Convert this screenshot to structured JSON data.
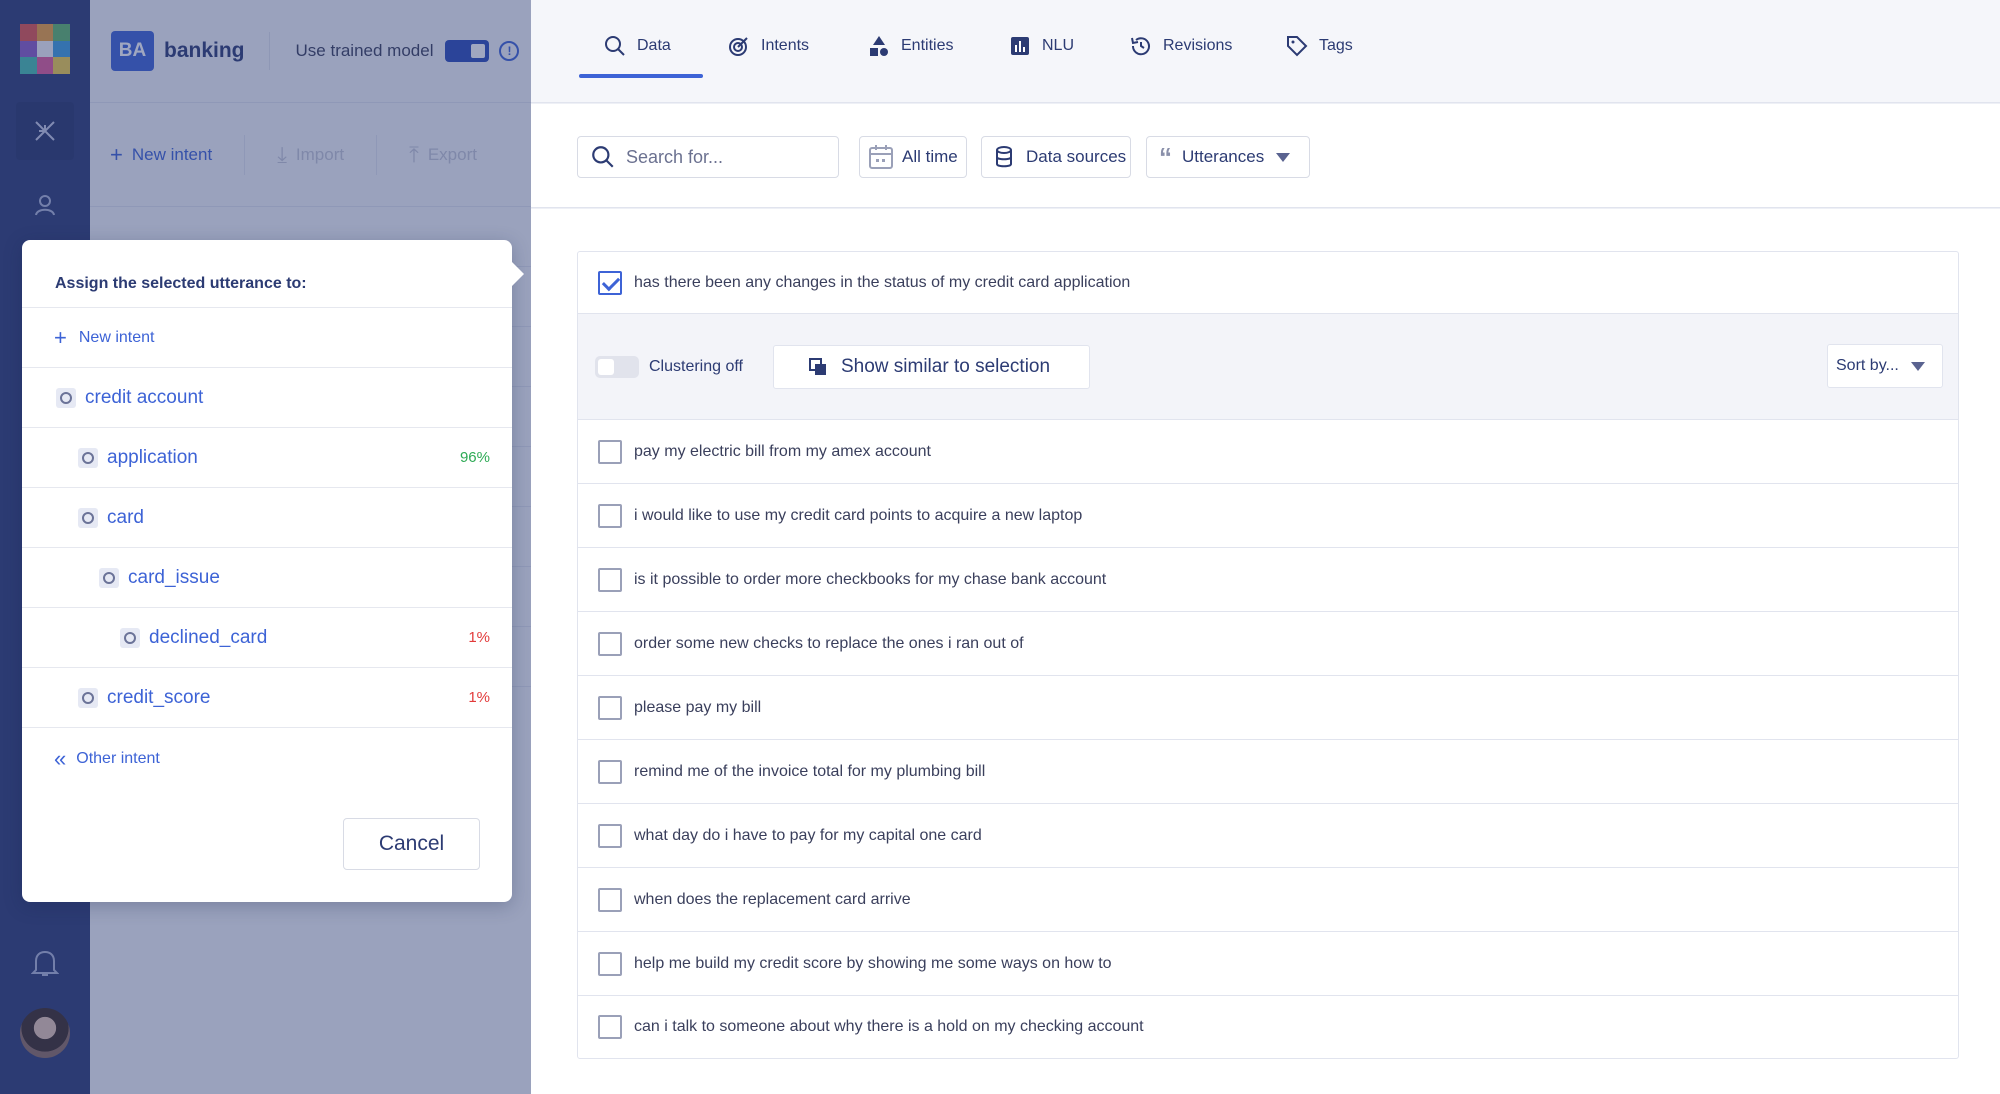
{
  "header": {
    "badge": "BA",
    "project": "banking",
    "trained_label": "Use trained model",
    "info": "!"
  },
  "toolbar": {
    "new_intent": "New intent",
    "import": "Import",
    "export": "Export"
  },
  "tabs": [
    {
      "label": "Data"
    },
    {
      "label": "Intents"
    },
    {
      "label": "Entities"
    },
    {
      "label": "NLU"
    },
    {
      "label": "Revisions"
    },
    {
      "label": "Tags"
    }
  ],
  "filters": {
    "search_placeholder": "Search for...",
    "time": "All time",
    "sources": "Data sources",
    "utterances": "Utterances"
  },
  "popup": {
    "title": "Assign the selected utterance to:",
    "new_intent": "New intent",
    "intents": [
      {
        "name": "credit account",
        "pct": ""
      },
      {
        "name": "application",
        "pct": "96%"
      },
      {
        "name": "card",
        "pct": ""
      },
      {
        "name": "card_issue",
        "pct": ""
      },
      {
        "name": "declined_card",
        "pct": "1%"
      },
      {
        "name": "credit_score",
        "pct": "1%"
      }
    ],
    "other_intent": "Other intent",
    "cancel": "Cancel"
  },
  "selected_utterance": "has there been any changes in the status of my credit card application",
  "clustering": {
    "label": "Clustering off",
    "similar": "Show similar to selection",
    "sort": "Sort by..."
  },
  "utterances": [
    "pay my electric bill from my amex account",
    "i would like to use my credit card points to acquire a new laptop",
    "is it possible to order more checkbooks for my chase bank account",
    "order some new checks to replace the ones i ran out of",
    "please pay my bill",
    "remind me of the invoice total for my plumbing bill",
    "what day do i have to pay for my capital one card",
    "when does the replacement card arrive",
    "help me build my credit score by showing me some ways on how to",
    "can i talk to someone about why there is a hold on my checking account"
  ],
  "colors": {
    "accent": "#3d63d6",
    "rail": "#2c3b73",
    "good": "#2eaa55",
    "bad": "#e23b3b"
  }
}
